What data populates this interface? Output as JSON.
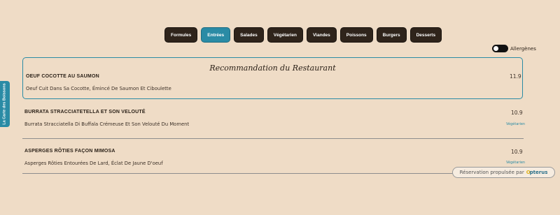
{
  "side_tab": {
    "label": "La Carte des Boissons"
  },
  "categories": [
    {
      "label": "Formules",
      "active": false
    },
    {
      "label": "Entrées",
      "active": true
    },
    {
      "label": "Salades",
      "active": false
    },
    {
      "label": "Végétarien",
      "active": false
    },
    {
      "label": "Viandes",
      "active": false
    },
    {
      "label": "Poissons",
      "active": false
    },
    {
      "label": "Burgers",
      "active": false
    },
    {
      "label": "Desserts",
      "active": false
    }
  ],
  "allergen_toggle": {
    "label": "Allergènes",
    "on": false
  },
  "recommendation": {
    "title": "Recommandation du Restaurant"
  },
  "items": [
    {
      "name": "OEUF COCOTTE AU SAUMON",
      "description": "Oeuf Cuit Dans Sa Cocotte, Émincé De Saumon Et Ciboulette",
      "price": "11.9",
      "tag": ""
    },
    {
      "name": "BURRATA STRACCIATETELLA ET SON VELOUTÉ",
      "description": "Burrata Stracciatella Di Buffala Crémeuse Et Son Velouté Du Moment",
      "price": "10.9",
      "tag": "Végétarien"
    },
    {
      "name": "ASPERGES RÔTIES FAÇON MIMOSA",
      "description": "Asperges Rôties Entourées De Lard, Éclat De Jaune D'oeuf",
      "price": "10.9",
      "tag": "Végétarien"
    }
  ],
  "reservation": {
    "text": "Réservation propulsée par",
    "brand_mark": "O",
    "brand": "pterus"
  },
  "colors": {
    "accent": "#2a8ba5",
    "button_dark": "#2f241b",
    "background": "#efdcc6"
  }
}
